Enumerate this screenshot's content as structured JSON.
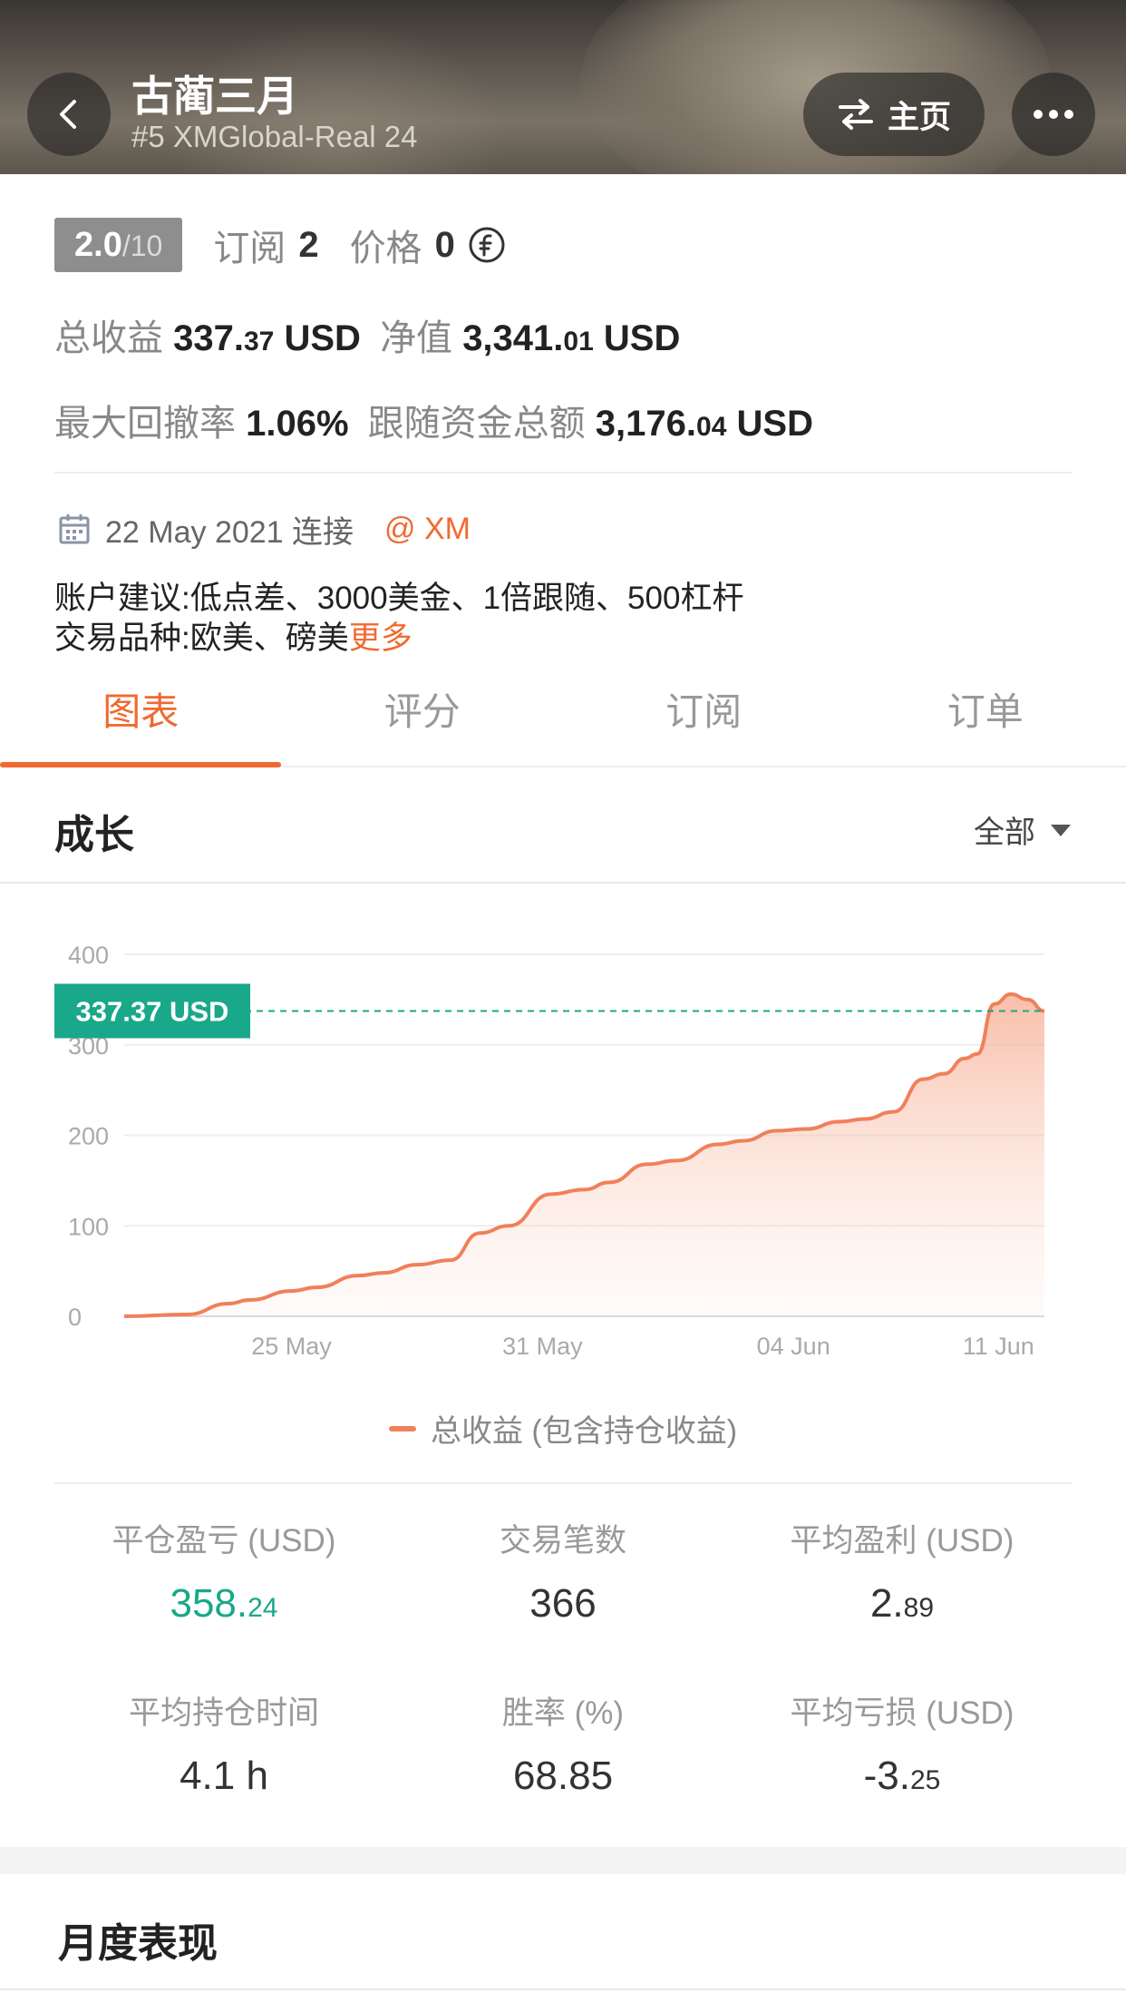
{
  "header": {
    "title": "古蔺三月",
    "subtitle": "#5 XMGlobal-Real 24",
    "home_label": "主页"
  },
  "rating": {
    "score": "2.0",
    "denominator": "/10"
  },
  "meta": {
    "subscribe_label": "订阅",
    "subscribe_count": "2",
    "price_label": "价格",
    "price_value": "0"
  },
  "stats_top": {
    "total_profit_label": "总收益",
    "total_profit_main": "337.",
    "total_profit_dec": "37",
    "total_profit_unit": " USD",
    "equity_label": "净值",
    "equity_main": "3,341.",
    "equity_dec": "01",
    "equity_unit": " USD",
    "max_dd_label": "最大回撤率",
    "max_dd_value": "1.06%",
    "follow_label": "跟随资金总额",
    "follow_main": "3,176.",
    "follow_dec": "04",
    "follow_unit": " USD"
  },
  "connection": {
    "date_text": "22 May 2021 连接",
    "broker": "@ XM"
  },
  "advice": {
    "line1": "账户建议:低点差、3000美金、1倍跟随、500杠杆",
    "line2": "交易品种:欧美、磅美",
    "more": "更多"
  },
  "tabs": [
    {
      "label": "图表"
    },
    {
      "label": "评分"
    },
    {
      "label": "订阅"
    },
    {
      "label": "订单"
    }
  ],
  "growth": {
    "title": "成长",
    "filter": "全部"
  },
  "chart_data": {
    "type": "area",
    "y_ticks": [
      "0",
      "100",
      "200",
      "300",
      "400"
    ],
    "ylim": [
      0,
      400
    ],
    "x_ticks": [
      {
        "label": "25 May",
        "x": 4
      },
      {
        "label": "31 May",
        "x": 10
      },
      {
        "label": "04 Jun",
        "x": 16
      },
      {
        "label": "11 Jun",
        "x": 20.9
      }
    ],
    "current_value_label": "337.37 USD",
    "current_value": 337.37,
    "series": [
      {
        "name": "总收益 (包含持仓收益)",
        "x": [
          0,
          1.5,
          2.5,
          3,
          4,
          4.6,
          5.6,
          6.2,
          7,
          7.8,
          8.5,
          9.2,
          10.2,
          11,
          11.6,
          12.5,
          13.2,
          14.2,
          14.8,
          15.6,
          16.3,
          17.1,
          17.7,
          18.4,
          19.1,
          19.6,
          20.1,
          20.4,
          20.8,
          21.2,
          21.6,
          22
        ],
        "values": [
          0,
          2,
          14,
          18,
          28,
          32,
          45,
          48,
          57,
          62,
          92,
          100,
          135,
          140,
          148,
          168,
          172,
          190,
          194,
          205,
          207,
          215,
          218,
          226,
          262,
          268,
          285,
          290,
          345,
          356,
          350,
          337.37
        ]
      }
    ]
  },
  "bottom_stats": [
    {
      "label": "平仓盈亏 (USD)",
      "main": "358.",
      "dec": "24",
      "green": true
    },
    {
      "label": "交易笔数",
      "main": "366",
      "dec": "",
      "green": false
    },
    {
      "label": "平均盈利 (USD)",
      "main": "2.",
      "dec": "89",
      "green": false
    },
    {
      "label": "平均持仓时间",
      "main": "4.1 h",
      "dec": "",
      "green": false
    },
    {
      "label": "胜率 (%)",
      "main": "68.85",
      "dec": "",
      "green": false
    },
    {
      "label": "平均亏损 (USD)",
      "main": "-3.",
      "dec": "25",
      "green": false
    }
  ],
  "monthly": {
    "title": "月度表现"
  },
  "colors": {
    "accent": "#f06a30",
    "line": "#f0805a",
    "current_value_bg": "#19a889",
    "green": "#19a889"
  }
}
